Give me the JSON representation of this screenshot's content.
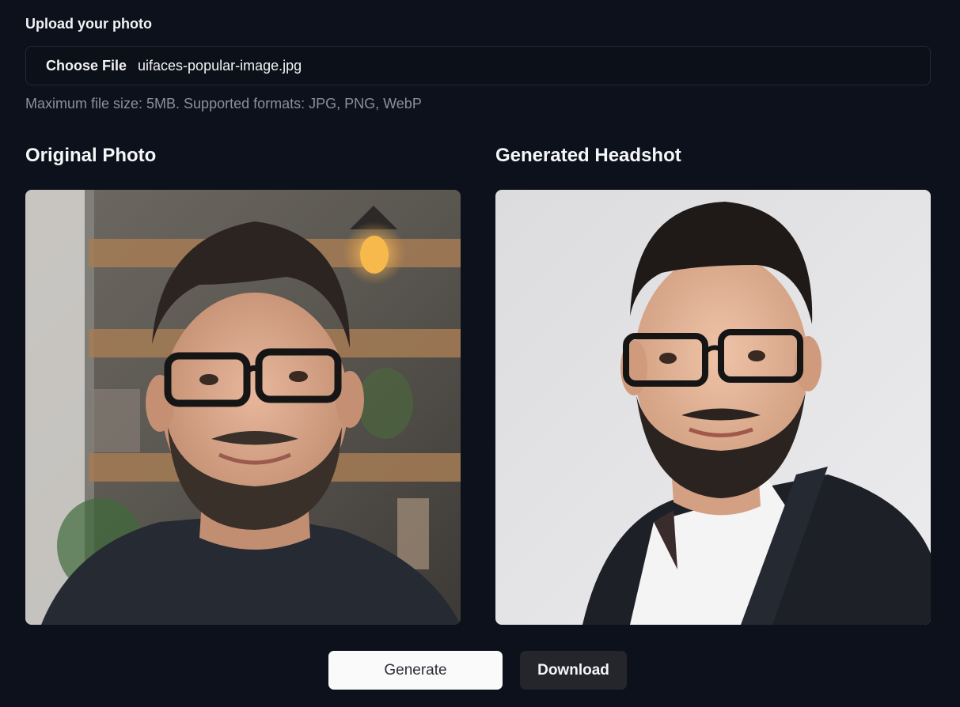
{
  "upload": {
    "label": "Upload your photo",
    "choose_button": "Choose File",
    "file_name": "uifaces-popular-image.jpg",
    "hint": "Maximum file size: 5MB. Supported formats: JPG, PNG, WebP"
  },
  "original": {
    "title": "Original Photo"
  },
  "generated": {
    "title": "Generated Headshot"
  },
  "actions": {
    "generate_label": "Generate",
    "download_label": "Download"
  },
  "colors": {
    "background": "#0d111b",
    "generate_button_bg": "#fafafa",
    "download_button_bg": "#24262b"
  }
}
